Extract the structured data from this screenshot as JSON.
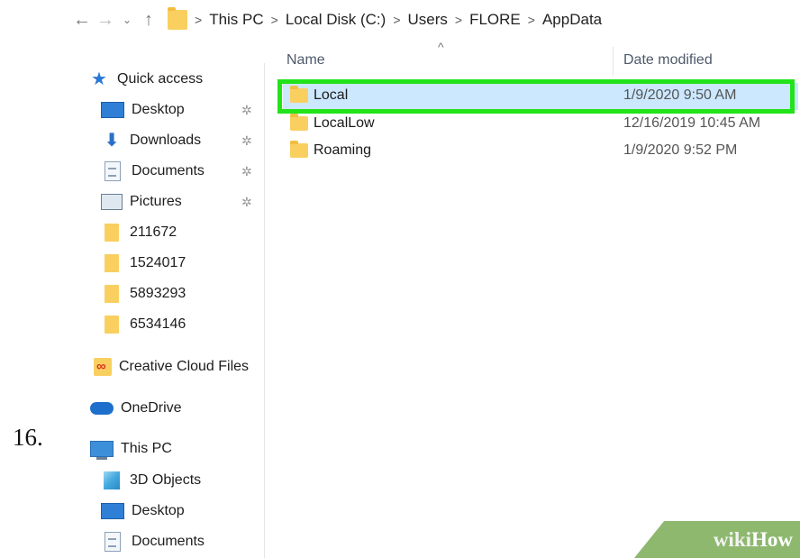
{
  "step_number": "16.",
  "address_bar": {
    "crumbs": [
      "This PC",
      "Local Disk (C:)",
      "Users",
      "FLORE",
      "AppData"
    ]
  },
  "file_list": {
    "columns": {
      "name": "Name",
      "date_modified": "Date modified"
    },
    "rows": [
      {
        "name": "Local",
        "date": "1/9/2020 9:50 AM",
        "selected": true
      },
      {
        "name": "LocalLow",
        "date": "12/16/2019 10:45 AM",
        "selected": false
      },
      {
        "name": "Roaming",
        "date": "1/9/2020 9:52 PM",
        "selected": false
      }
    ]
  },
  "sidebar": {
    "items": [
      {
        "label": "Quick access",
        "icon": "star-icon",
        "pinned": false
      },
      {
        "label": "Desktop",
        "icon": "desktop-icon",
        "pinned": true
      },
      {
        "label": "Downloads",
        "icon": "download-icon",
        "pinned": true
      },
      {
        "label": "Documents",
        "icon": "document-icon",
        "pinned": true
      },
      {
        "label": "Pictures",
        "icon": "pictures-icon",
        "pinned": true
      },
      {
        "label": "211672",
        "icon": "folder-icon",
        "pinned": false
      },
      {
        "label": "1524017",
        "icon": "folder-icon",
        "pinned": false
      },
      {
        "label": "5893293",
        "icon": "folder-icon",
        "pinned": false
      },
      {
        "label": "6534146",
        "icon": "folder-icon",
        "pinned": false
      },
      {
        "label": "Creative Cloud Files",
        "icon": "creative-cloud-icon",
        "pinned": false
      },
      {
        "label": "OneDrive",
        "icon": "onedrive-cloud-icon",
        "pinned": false
      },
      {
        "label": "This PC",
        "icon": "computer-icon",
        "pinned": false
      },
      {
        "label": "3D Objects",
        "icon": "3d-objects-icon",
        "pinned": false
      },
      {
        "label": "Desktop",
        "icon": "desktop-icon",
        "pinned": false
      },
      {
        "label": "Documents",
        "icon": "document-icon",
        "pinned": false
      }
    ]
  },
  "watermark": {
    "part1": "wiki",
    "part2": "How"
  },
  "colors": {
    "highlight_border": "#22e31a",
    "selection_bg": "#cce8ff",
    "folder_yellow": "#f9cf5f",
    "watermark_green": "#8db86e"
  }
}
